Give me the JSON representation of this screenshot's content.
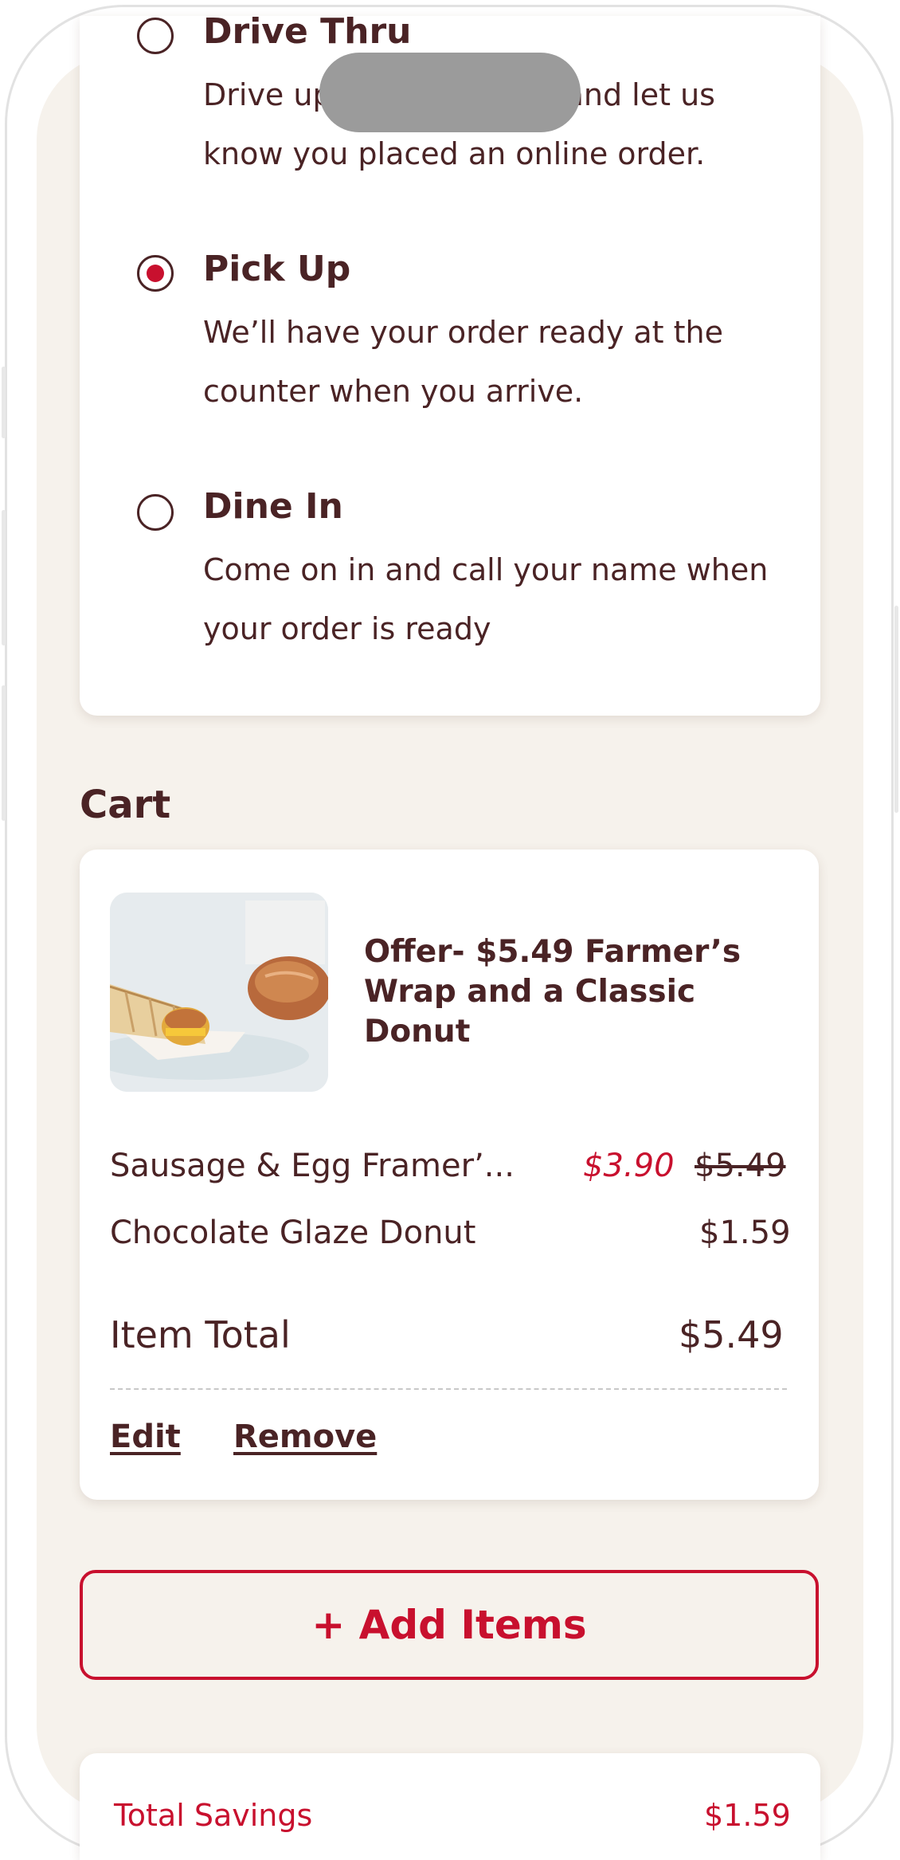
{
  "order_type": {
    "options": [
      {
        "title": "Drive Thru",
        "description": "Drive up to the window and let us know you placed an online order.",
        "selected": false
      },
      {
        "title": "Pick Up",
        "description": "We’ll have your order ready at the counter when you arrive.",
        "selected": true
      },
      {
        "title": "Dine In",
        "description": "Come on in and call your name when your order is ready",
        "selected": false
      }
    ]
  },
  "cart": {
    "heading": "Cart",
    "offer_title": "Offer- $5.49 Farmer’s Wrap and a Classic Donut",
    "items": [
      {
        "name": "Sausage & Egg Framer’...",
        "sale_price": "$3.90",
        "original_price": "$5.49"
      },
      {
        "name": "Chocolate Glaze Donut",
        "price": "$1.59"
      }
    ],
    "item_total_label": "Item Total",
    "item_total_value": "$5.49",
    "edit_label": "Edit",
    "remove_label": "Remove"
  },
  "add_items_label": "+ Add Items",
  "summary": {
    "total_savings_label": "Total Savings",
    "total_savings_value": "$1.59"
  },
  "colors": {
    "accent": "#c8102e",
    "text": "#4a2325",
    "background": "#f6f2ec"
  }
}
